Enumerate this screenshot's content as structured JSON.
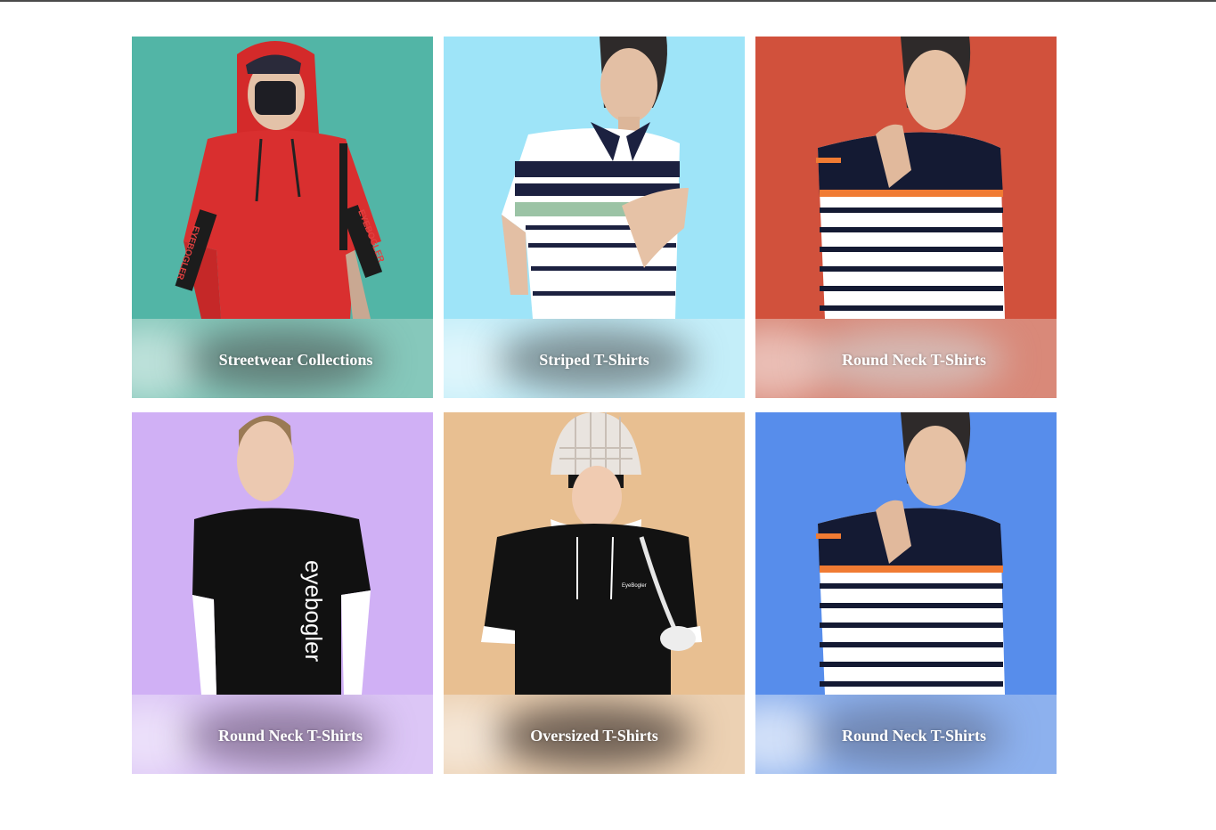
{
  "colors": {
    "top_rule": "#4a4a4a",
    "page_background": "#ffffff"
  },
  "categories": [
    {
      "title": "Streetwear Collections",
      "background": "#52b5a6",
      "band": "#86c8bb",
      "image": "Model in red hooded streetwear top with black face mask"
    },
    {
      "title": "Striped T-Shirts",
      "background": "#9ee4f8",
      "band": "#c4eef9",
      "image": "Model in navy and white striped polo shirt"
    },
    {
      "title": "Round Neck T-Shirts",
      "background": "#d1513c",
      "band": "#d98979",
      "image": "Model in navy, orange and white striped long-sleeve round neck t-shirt"
    },
    {
      "title": "Round Neck T-Shirts",
      "background": "#d0b0f5",
      "band": "#dcc6f6",
      "image": "Model in black eyebogler round neck t-shirt with white sleeves"
    },
    {
      "title": "Oversized T-Shirts",
      "background": "#e8bf91",
      "band": "#ecd1b3",
      "image": "Model in black oversized hooded t-shirt and checked bucket hat"
    },
    {
      "title": "Round Neck T-Shirts",
      "background": "#578deb",
      "band": "#8db1ee",
      "image": "Model in striped long-sleeve round neck t-shirt"
    }
  ],
  "print_text": {
    "sleeve_left": "EYEBOGLER",
    "sleeve_right": "EYEBOGLER",
    "tee_print": "eyebogler",
    "hoodie_print": "EyeBogler"
  }
}
